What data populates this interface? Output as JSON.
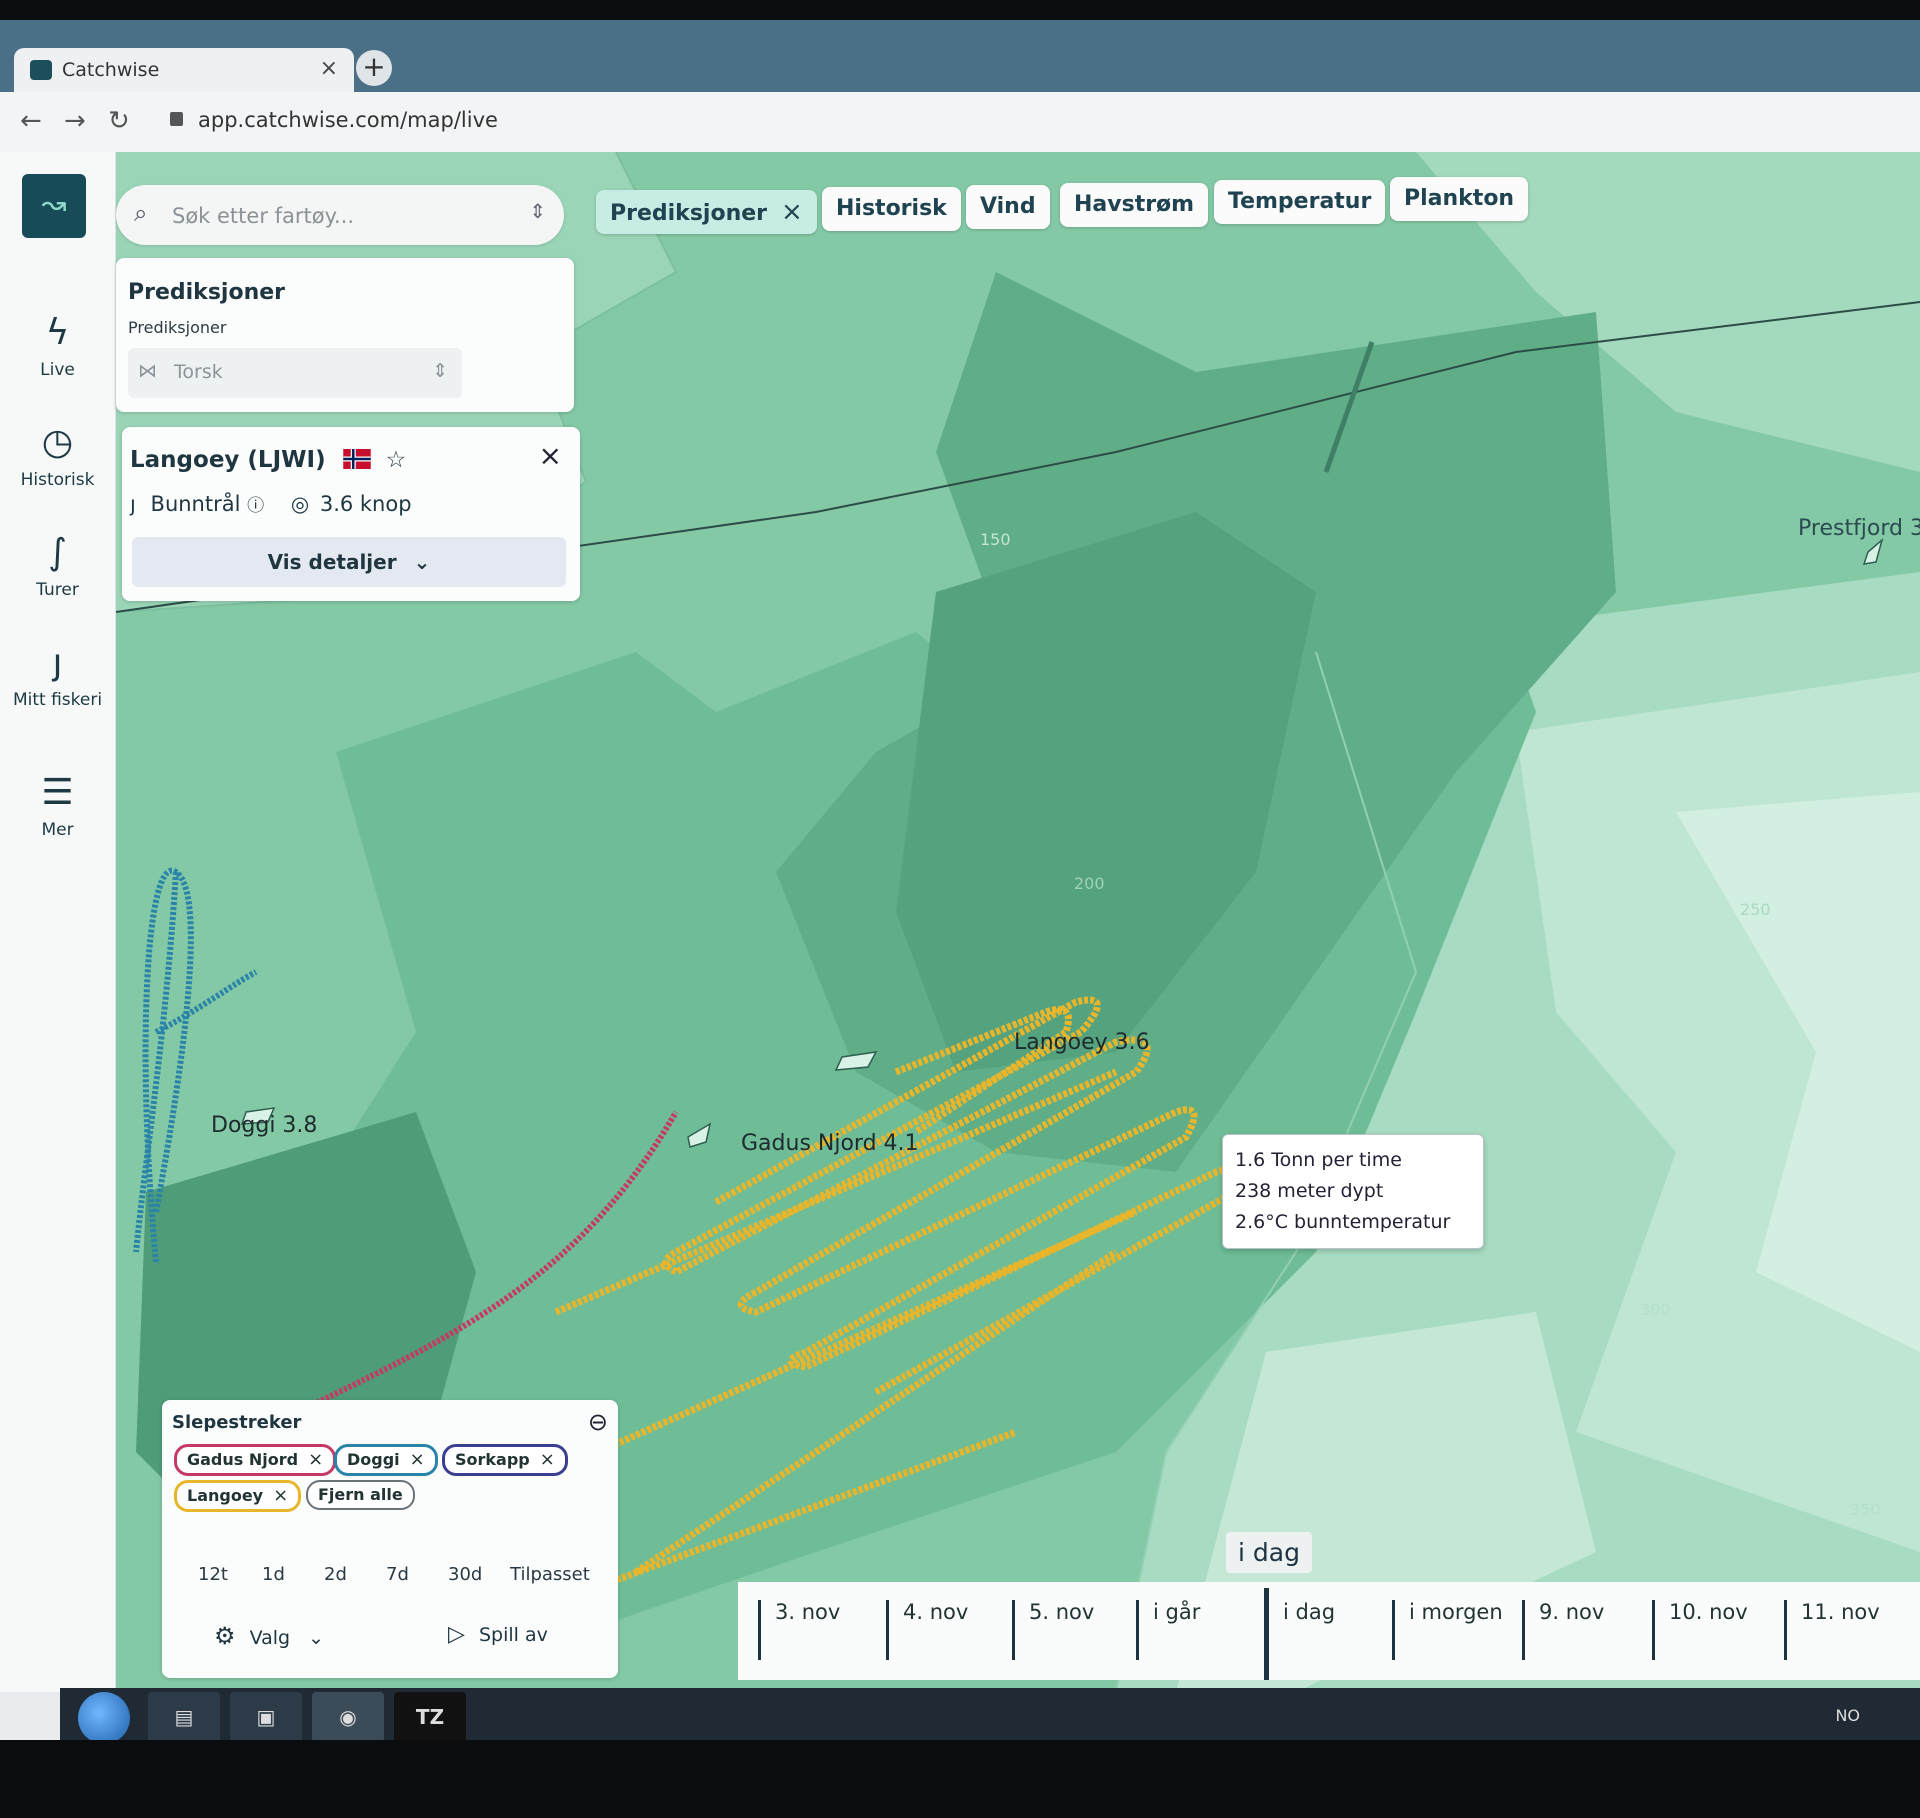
{
  "browser": {
    "tab_title": "Catchwise",
    "tab_close": "×",
    "new_tab": "+",
    "url": "app.catchwise.com/map/live"
  },
  "sidebar": {
    "items": [
      {
        "label": "Live",
        "icon": "lightning-icon"
      },
      {
        "label": "Historisk",
        "icon": "history-clock-icon"
      },
      {
        "label": "Turer",
        "icon": "route-icon"
      },
      {
        "label": "Mitt fiskeri",
        "icon": "hook-icon"
      },
      {
        "label": "Mer",
        "icon": "menu-icon"
      }
    ]
  },
  "search": {
    "placeholder": "Søk etter fartøy..."
  },
  "layers": {
    "items": [
      {
        "label": "Prediksjoner",
        "active": true,
        "close": "×"
      },
      {
        "label": "Historisk"
      },
      {
        "label": "Vind"
      },
      {
        "label": "Havstrøm"
      },
      {
        "label": "Temperatur"
      },
      {
        "label": "Plankton"
      }
    ]
  },
  "predictions_panel": {
    "title": "Prediksjoner",
    "subtitle": "Prediksjoner",
    "species": "Torsk"
  },
  "vessel_panel": {
    "name": "Langoey (LJWI)",
    "gear": "Bunntrål",
    "speed": "3.6 knop",
    "details_button": "Vis detaljer",
    "close": "×"
  },
  "map": {
    "vessels": [
      {
        "label": "Langoey 3.6"
      },
      {
        "label": "Gadus Njord 4.1"
      },
      {
        "label": "Doggi 3.8"
      }
    ],
    "place_label": "Prestfjord 3",
    "depth_labels": [
      "150",
      "200",
      "250",
      "300",
      "350"
    ],
    "colors": {
      "langoey_track": "#e8b52b",
      "gadus_track": "#c43a64",
      "doggi_track": "#2a84a8",
      "sorkapp_tag": "#3a3f8f"
    }
  },
  "tooltip": {
    "line1": "1.6 Tonn per time",
    "line2": "238 meter dypt",
    "line3": "2.6°C bunntemperatur"
  },
  "tracks_panel": {
    "title": "Slepestreker",
    "tags": [
      {
        "label": "Gadus Njord"
      },
      {
        "label": "Doggi"
      },
      {
        "label": "Sorkapp"
      },
      {
        "label": "Langoey"
      }
    ],
    "remove_all": "Fjern alle",
    "periods": [
      "12t",
      "1d",
      "2d",
      "7d",
      "30d",
      "Tilpasset"
    ],
    "options_label": "Valg",
    "play_label": "Spill av"
  },
  "timeline": {
    "today_badge": "i dag",
    "ticks": [
      "3. nov",
      "4. nov",
      "5. nov",
      "i går",
      "i dag",
      "i morgen",
      "9. nov",
      "10. nov",
      "11. nov"
    ]
  },
  "taskbar": {
    "tz": "TZ",
    "lang": "NO"
  }
}
